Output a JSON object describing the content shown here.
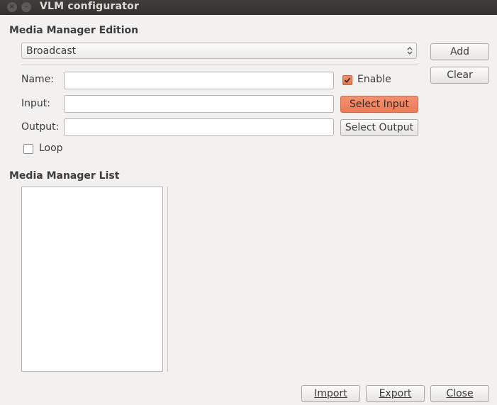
{
  "window": {
    "title": "VLM configurator",
    "close_glyph": "×",
    "minimize_glyph": "–"
  },
  "edition": {
    "section_label": "Media Manager Edition",
    "type_select_value": "Broadcast",
    "name_label": "Name:",
    "name_value": "",
    "input_label": "Input:",
    "input_value": "",
    "output_label": "Output:",
    "output_value": "",
    "enable_label": "Enable",
    "enable_checked": true,
    "loop_label": "Loop",
    "loop_checked": false,
    "select_input_label": "Select Input",
    "select_output_label": "Select Output",
    "add_label": "Add",
    "clear_label": "Clear"
  },
  "list": {
    "section_label": "Media Manager List",
    "items": []
  },
  "footer": {
    "import_label": "Import",
    "export_label": "Export",
    "close_label": "Close"
  },
  "colors": {
    "accent": "#eb7b56",
    "titlebar": "#3a3936",
    "background": "#f2f1f0"
  }
}
